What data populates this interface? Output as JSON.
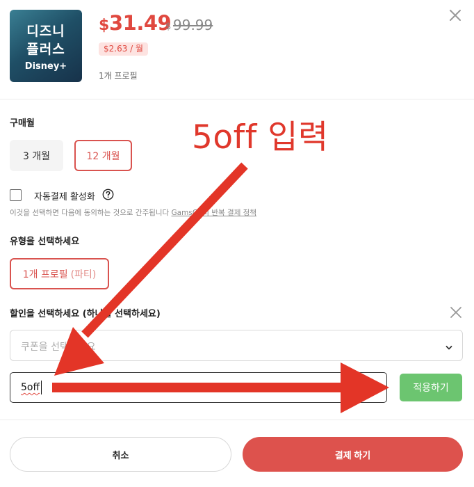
{
  "product": {
    "thumbnail": {
      "line1": "디즈니",
      "line2": "플러스",
      "line3": "Disney+"
    },
    "currency_symbol": "$",
    "price": "31.49",
    "original_currency": "$",
    "original_price": "99.99",
    "monthly_badge": "$2.63 / 월",
    "profile_note": "1개 프로필"
  },
  "purchase_period": {
    "title": "구매월",
    "options": [
      {
        "label": "3 개월",
        "selected": false
      },
      {
        "label": "12 개월",
        "selected": true
      }
    ]
  },
  "autopay": {
    "label": "자동결제 활성화",
    "checked": false,
    "consent_prefix": "이것을 선택하면 다음에 동의하는 것으로 간주됩니다 ",
    "consent_link": "GamsGo의 반복 결제 정책"
  },
  "type_section": {
    "title": "유형을 선택하세요",
    "option_main": "1개 프로필",
    "option_sub": "(파티)"
  },
  "discount": {
    "title": "할인을 선택하세요 (하나를 선택하세요)",
    "coupon_placeholder": "쿠폰을 선택하세요",
    "code_value": "5off",
    "apply_label": "적용하기"
  },
  "footer": {
    "cancel_label": "취소",
    "pay_label": "결제 하기"
  },
  "annotation": {
    "text": "5off 입력"
  },
  "colors": {
    "accent_red": "#dd524d",
    "price_red": "#e0483f",
    "apply_green": "#6cc570",
    "annotation_red": "#e0382c"
  },
  "icons": {
    "close": "close-icon",
    "help": "help-circle-icon",
    "dropdown": "chevron-down-icon"
  }
}
